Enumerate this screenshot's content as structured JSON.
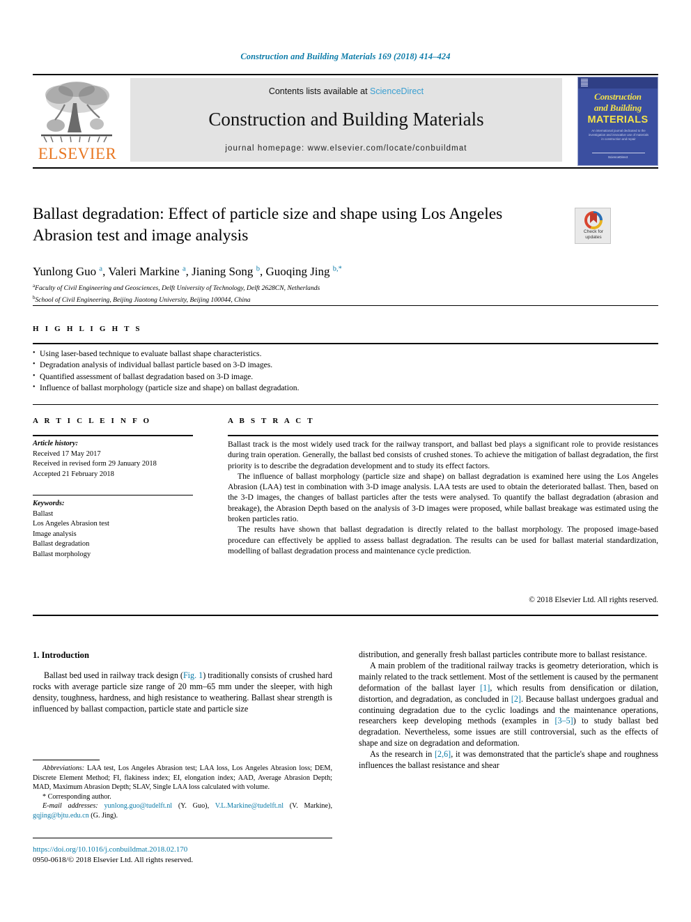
{
  "running_head": "Construction and Building Materials 169 (2018) 414–424",
  "masthead": {
    "publisher_name": "ELSEVIER",
    "contents_line_prefix": "Contents lists available at ",
    "contents_link": "ScienceDirect",
    "journal_title": "Construction and Building Materials",
    "homepage": "journal homepage: www.elsevier.com/locate/conbuildmat",
    "cover": {
      "line1": "Construction",
      "line2": "and Building",
      "line3": "MATERIALS",
      "blurb": "An international journal dedicated to the investigation and innovative use of materials in construction and repair",
      "footer": "ScienceDirect"
    }
  },
  "article": {
    "title": "Ballast degradation: Effect of particle size and shape using Los Angeles Abrasion test and image analysis",
    "crossmark_label_line1": "Check for",
    "crossmark_label_line2": "updates",
    "authors_html": "Yunlong Guo <sup>a</sup>, Valeri Markine <sup>a</sup>, Jianing Song <sup>b</sup>, Guoqing Jing <sup>b,</sup><sup>*</sup>",
    "affiliations": [
      "Faculty of Civil Engineering and Geosciences, Delft University of Technology, Delft 2628CN, Netherlands",
      "School of Civil Engineering, Beijing Jiaotong University, Beijing 100044, China"
    ],
    "affiliation_marks": [
      "a",
      "b"
    ]
  },
  "highlights": {
    "label": "H I G H L I G H T S",
    "items": [
      "Using laser-based technique to evaluate ballast shape characteristics.",
      "Degradation analysis of individual ballast particle based on 3-D images.",
      "Quantified assessment of ballast degradation based on 3-D image.",
      "Influence of ballast morphology (particle size and shape) on ballast degradation."
    ]
  },
  "article_info": {
    "label": "A R T I C L E    I N F O",
    "history_label": "Article history:",
    "history": [
      "Received 17 May 2017",
      "Received in revised form 29 January 2018",
      "Accepted 21 February 2018"
    ],
    "keywords_label": "Keywords:",
    "keywords": [
      "Ballast",
      "Los Angeles Abrasion test",
      "Image analysis",
      "Ballast degradation",
      "Ballast morphology"
    ]
  },
  "abstract": {
    "label": "A B S T R A C T",
    "paragraphs": [
      "Ballast track is the most widely used track for the railway transport, and ballast bed plays a significant role to provide resistances during train operation. Generally, the ballast bed consists of crushed stones. To achieve the mitigation of ballast degradation, the first priority is to describe the degradation development and to study its effect factors.",
      "The influence of ballast morphology (particle size and shape) on ballast degradation is examined here using the Los Angeles Abrasion (LAA) test in combination with 3-D image analysis. LAA tests are used to obtain the deteriorated ballast. Then, based on the 3-D images, the changes of ballast particles after the tests were analysed. To quantify the ballast degradation (abrasion and breakage), the Abrasion Depth based on the analysis of 3-D images were proposed, while ballast breakage was estimated using the broken particles ratio.",
      "The results have shown that ballast degradation is directly related to the ballast morphology. The proposed image-based procedure can effectively be applied to assess ballast degradation. The results can be used for ballast material standardization, modelling of ballast degradation process and maintenance cycle prediction."
    ],
    "copyright": "© 2018 Elsevier Ltd. All rights reserved."
  },
  "body": {
    "section_heading": "1. Introduction",
    "left_paragraph_1_part1": "Ballast bed used in railway track design (",
    "left_ref_fig1": "Fig. 1",
    "left_paragraph_1_part2": ") traditionally consists of crushed hard rocks with average particle size range of 20 mm–65 mm under the sleeper, with high density, toughness, hardness, and high resistance to weathering. Ballast shear strength is influenced by ballast compaction, particle state and particle size",
    "right_paragraph_1": "distribution, and generally fresh ballast particles contribute more to ballast resistance.",
    "right_p2_a": "A main problem of the traditional railway tracks is geometry deterioration, which is mainly related to the track settlement. Most of the settlement is caused by the permanent deformation of the ballast layer ",
    "right_ref_1": "[1]",
    "right_p2_b": ", which results from densification or dilation, distortion, and degradation, as concluded in ",
    "right_ref_2": "[2]",
    "right_p2_c": ". Because ballast undergoes gradual and continuing degradation due to the cyclic loadings and the maintenance operations, researchers keep developing methods (examples in ",
    "right_ref_35": "[3–5]",
    "right_p2_d": ") to study ballast bed degradation. Nevertheless, some issues are still controversial, such as the effects of shape and size on degradation and deformation.",
    "right_p3_a": "As the research in ",
    "right_ref_26": "[2,6]",
    "right_p3_b": ", it was demonstrated that the particle's shape and roughness influences the ballast resistance and shear"
  },
  "footnotes": {
    "abbreviations_label": "Abbreviations:",
    "abbreviations_text": " LAA test, Los Angeles Abrasion test; LAA loss, Los Angeles Abrasion loss; DEM, Discrete Element Method; FI, flakiness index; EI, elongation index; AAD, Average Abrasion Depth; MAD, Maximum Abrasion Depth; SLAV, Single LAA loss calculated with volume.",
    "corresponding_author": "* Corresponding author.",
    "email_label": "E-mail addresses:",
    "email_1": "yunlong.guo@tudelft.nl",
    "email_1_owner": " (Y. Guo), ",
    "email_2": "V.L.Markine@tudelft.nl",
    "email_2_owner": " (V. Markine), ",
    "email_3": "gqjing@bjtu.edu.cn",
    "email_3_owner": " (G. Jing)."
  },
  "bottom": {
    "doi": "https://doi.org/10.1016/j.conbuildmat.2018.02.170",
    "issn_copyright": "0950-0618/© 2018 Elsevier Ltd. All rights reserved."
  },
  "colors": {
    "link_blue": "#0b7ba8",
    "sciencedirect_blue": "#3a9fd1",
    "elsevier_orange": "#E87722",
    "banner_grey": "#e3e3e3",
    "cover_blue": "#3b4fa0",
    "cover_yellow": "#f3e24a"
  }
}
